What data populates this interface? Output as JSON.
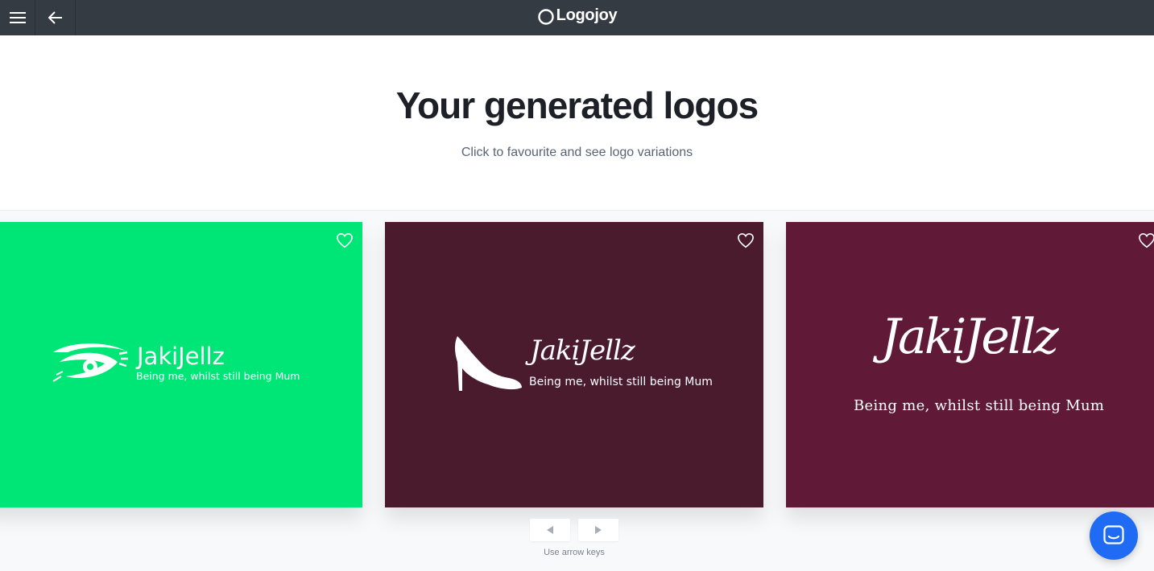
{
  "header": {
    "brand": "Logojoy",
    "menu_icon": "hamburger-menu-icon",
    "back_icon": "arrow-left-icon",
    "brand_icon": "circle-logo-icon",
    "background": "#353b42"
  },
  "hero": {
    "title": "Your generated logos",
    "subtitle": "Click to favourite and see logo variations"
  },
  "cards": [
    {
      "background": "#00e676",
      "icon": "eye-lash-icon",
      "name": "JakiJellz",
      "tagline": "Being me, whilst still being Mum",
      "heart_icon": "heart-outline-icon"
    },
    {
      "background": "#4a1a2d",
      "icon": "high-heel-shoe-icon",
      "name": "JakiJellz",
      "tagline": "Being me, whilst still being Mum",
      "heart_icon": "heart-outline-icon"
    },
    {
      "background": "#601936",
      "icon": "",
      "name": "JakiJellz",
      "tagline": "Being me, whilst still being Mum",
      "heart_icon": "heart-outline-icon"
    }
  ],
  "navigation": {
    "prev_icon": "triangle-left-icon",
    "next_icon": "triangle-right-icon",
    "hint": "Use arrow keys"
  },
  "chat": {
    "icon": "chat-bubble-icon",
    "color": "#1f6bf4"
  }
}
